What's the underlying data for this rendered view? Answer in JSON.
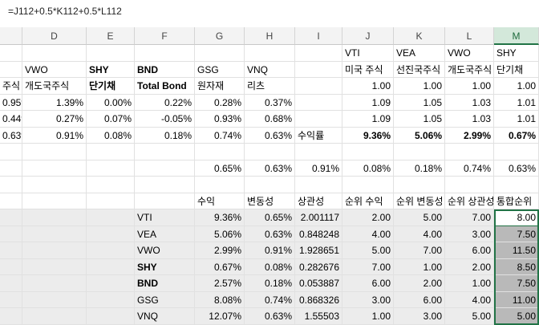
{
  "formula_bar": {
    "formula": "=J112+0.5*K112+0.5*L112"
  },
  "columns": [
    {
      "id": "C",
      "label": ""
    },
    {
      "id": "D",
      "label": "D"
    },
    {
      "id": "E",
      "label": "E"
    },
    {
      "id": "F",
      "label": "F"
    },
    {
      "id": "G",
      "label": "G"
    },
    {
      "id": "H",
      "label": "H"
    },
    {
      "id": "I",
      "label": "I"
    },
    {
      "id": "J",
      "label": "J"
    },
    {
      "id": "K",
      "label": "K"
    },
    {
      "id": "L",
      "label": "L"
    },
    {
      "id": "M",
      "label": "M"
    }
  ],
  "rows": [
    [
      "",
      "",
      "",
      "",
      "",
      "",
      "",
      "VTI",
      "VEA",
      "VWO",
      "SHY"
    ],
    [
      "",
      "VWO",
      "SHY",
      "BND",
      "GSG",
      "VNQ",
      "",
      "미국 주식",
      "선진국주식",
      "개도국주식",
      "단기채"
    ],
    [
      "주식",
      "개도국주식",
      "단기채",
      "Total Bond",
      "원자재",
      "리츠",
      "",
      "1.00",
      "1.00",
      "1.00",
      "1.00"
    ],
    [
      "0.95%",
      "1.39%",
      "0.00%",
      "0.22%",
      "0.28%",
      "0.37%",
      "",
      "1.09",
      "1.05",
      "1.03",
      "1.01"
    ],
    [
      "0.44%",
      "0.27%",
      "0.07%",
      "-0.05%",
      "0.93%",
      "0.68%",
      "",
      "1.09",
      "1.05",
      "1.03",
      "1.01"
    ],
    [
      "0.63%",
      "0.91%",
      "0.08%",
      "0.18%",
      "0.74%",
      "0.63%",
      "수익률",
      "9.36%",
      "5.06%",
      "2.99%",
      "0.67%"
    ],
    [
      "",
      "",
      "",
      "",
      "",
      "",
      "",
      "",
      "",
      "",
      ""
    ],
    [
      "",
      "",
      "",
      "",
      "0.65%",
      "0.63%",
      "0.91%",
      "0.08%",
      "0.18%",
      "0.74%",
      "0.63%"
    ],
    [
      "",
      "",
      "",
      "",
      "",
      "",
      "",
      "",
      "",
      "",
      ""
    ],
    [
      "",
      "",
      "",
      "",
      "수익",
      "변동성",
      "상관성",
      "순위 수익",
      "순위 변동성",
      "순위 상관성",
      "통합순위"
    ],
    [
      "",
      "",
      "",
      "VTI",
      "9.36%",
      "0.65%",
      "2.001117",
      "2.00",
      "5.00",
      "7.00",
      "8.00"
    ],
    [
      "",
      "",
      "",
      "VEA",
      "5.06%",
      "0.63%",
      "0.848248",
      "4.00",
      "4.00",
      "3.00",
      "7.50"
    ],
    [
      "",
      "",
      "",
      "VWO",
      "2.99%",
      "0.91%",
      "1.928651",
      "5.00",
      "7.00",
      "6.00",
      "11.50"
    ],
    [
      "",
      "",
      "",
      "SHY",
      "0.67%",
      "0.08%",
      "0.282676",
      "7.00",
      "1.00",
      "2.00",
      "8.50"
    ],
    [
      "",
      "",
      "",
      "BND",
      "2.57%",
      "0.18%",
      "0.053887",
      "6.00",
      "2.00",
      "1.00",
      "7.50"
    ],
    [
      "",
      "",
      "",
      "GSG",
      "8.08%",
      "0.74%",
      "0.868326",
      "3.00",
      "6.00",
      "4.00",
      "11.00"
    ],
    [
      "",
      "",
      "",
      "VNQ",
      "12.07%",
      "0.63%",
      "1.55503",
      "1.00",
      "3.00",
      "5.00",
      "5.00"
    ]
  ]
}
